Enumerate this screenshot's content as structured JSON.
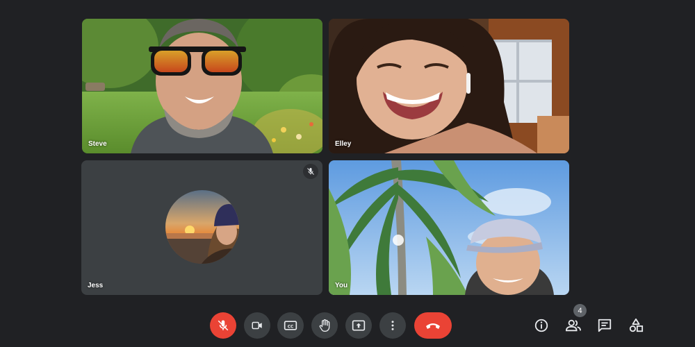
{
  "participants": {
    "steve": {
      "name": "Steve"
    },
    "elley": {
      "name": "Elley"
    },
    "jess": {
      "name": "Jess",
      "muted": true
    },
    "you": {
      "name": "You"
    }
  },
  "controls": {
    "mic": {
      "icon": "mic-off-icon",
      "state": "muted",
      "color": "#ea4335"
    },
    "camera": {
      "icon": "videocam-icon"
    },
    "captions": {
      "icon": "closed-captions-icon"
    },
    "raise_hand": {
      "icon": "hand-icon"
    },
    "present": {
      "icon": "present-screen-icon"
    },
    "more": {
      "icon": "more-vert-icon"
    },
    "leave": {
      "icon": "call-end-icon",
      "color": "#ea4335"
    }
  },
  "side_controls": {
    "info": {
      "icon": "info-icon"
    },
    "people": {
      "icon": "people-icon",
      "count": "4"
    },
    "chat": {
      "icon": "chat-icon"
    },
    "activities": {
      "icon": "activities-icon"
    }
  },
  "theme": {
    "background": "#202124",
    "control_bg": "#3c4043",
    "danger": "#ea4335"
  }
}
